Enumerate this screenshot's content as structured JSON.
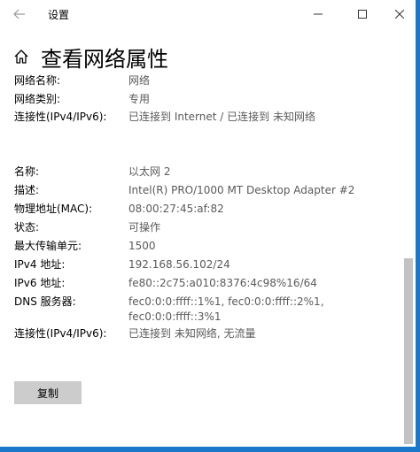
{
  "window": {
    "title": "设置"
  },
  "header": {
    "title": "查看网络属性"
  },
  "groups": {
    "general": [
      {
        "label": "网络名称:",
        "value": [
          "网络"
        ]
      },
      {
        "label": "网络类别:",
        "value": [
          "专用"
        ]
      },
      {
        "label": "连接性(IPv4/IPv6):",
        "value": [
          "已连接到 Internet / 已连接到 未知网络"
        ]
      }
    ],
    "adapter": [
      {
        "label": "名称:",
        "value": [
          "以太网 2"
        ]
      },
      {
        "label": "描述:",
        "value": [
          "Intel(R) PRO/1000 MT Desktop Adapter #2"
        ]
      },
      {
        "label": "物理地址(MAC):",
        "value": [
          "08:00:27:45:af:82"
        ]
      },
      {
        "label": "状态:",
        "value": [
          "可操作"
        ]
      },
      {
        "label": "最大传输单元:",
        "value": [
          "1500"
        ]
      },
      {
        "label": "IPv4 地址:",
        "value": [
          "192.168.56.102/24"
        ]
      },
      {
        "label": "IPv6 地址:",
        "value": [
          "fe80::2c75:a010:8376:4c98%16/64"
        ]
      },
      {
        "label": "DNS 服务器:",
        "value": [
          "fec0:0:0:ffff::1%1, fec0:0:0:ffff::2%1,",
          "fec0:0:0:ffff::3%1"
        ]
      },
      {
        "label": "连接性(IPv4/IPv6):",
        "value": [
          "已连接到 未知网络, 无流量"
        ]
      }
    ]
  },
  "actions": {
    "copy_label": "复制"
  },
  "icons": {
    "back": "back-arrow-icon",
    "home": "home-icon",
    "minimize": "minimize-icon",
    "maximize": "maximize-icon",
    "close": "close-icon"
  },
  "colors": {
    "accent_border": "#1b77c9",
    "value_text": "#5a5a5a",
    "button_bg": "#cccccc"
  }
}
